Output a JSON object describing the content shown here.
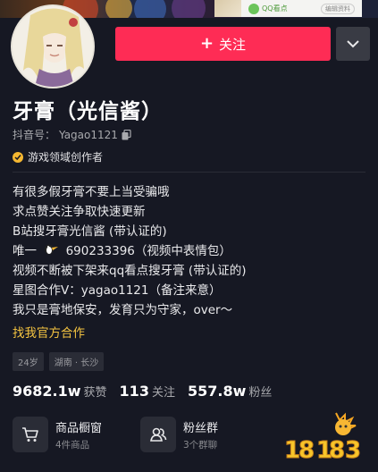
{
  "banner": {
    "ad_brand": "QQ看点",
    "ad_link": "编辑资料"
  },
  "profile": {
    "name": "牙膏（光信酱）",
    "douyin_id_label": "抖音号：",
    "douyin_id": "Yagao1121",
    "creator_badge": "游戏领域创作者"
  },
  "actions": {
    "follow_label": "关注"
  },
  "bio": {
    "lines": [
      "有很多假牙膏不要上当受骗哦",
      "求点赞关注争取快速更新",
      "B站搜牙膏光信酱 (带认证的)",
      "690233396（视频中表情包）",
      "视频不断被下架来qq看点搜牙膏 (带认证的)",
      "星图合作V：yagao1121（备注来意）",
      "我只是膏地保安，发育只为守家，over～"
    ],
    "line4_prefix": "唯一"
  },
  "official_link": "找我官方合作",
  "tags": [
    "24岁",
    "湖南 · 长沙"
  ],
  "stats": [
    {
      "num": "9682.1w",
      "label": "获赞"
    },
    {
      "num": "113",
      "label": "关注"
    },
    {
      "num": "557.8w",
      "label": "粉丝"
    }
  ],
  "entries": [
    {
      "title": "商品橱窗",
      "sub": "4件商品",
      "icon": "shopping-cart-icon"
    },
    {
      "title": "粉丝群",
      "sub": "3个群聊",
      "icon": "fan-group-icon"
    }
  ],
  "colors": {
    "background": "#161823",
    "follow": "#fe2c55",
    "link": "#f5c441",
    "creator_badge": "#f5b731"
  }
}
